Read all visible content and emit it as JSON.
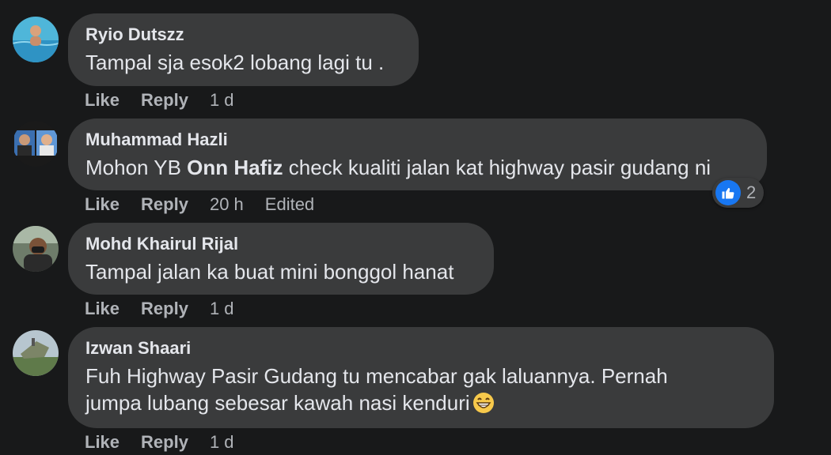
{
  "comments": [
    {
      "author": "Ryio Dutszz",
      "text": "Tampal sja esok2 lobang lagi tu .",
      "like_label": "Like",
      "reply_label": "Reply",
      "time": "1 d"
    },
    {
      "author": "Muhammad Hazli",
      "text_before": "Mohon YB ",
      "mention": "Onn Hafiz",
      "text_after": " check kualiti jalan kat highway pasir gudang ni",
      "like_label": "Like",
      "reply_label": "Reply",
      "time": "20 h",
      "edited_label": "Edited",
      "reaction": {
        "icon": "thumbs-up-icon",
        "count": "2",
        "color": "#1877f2"
      }
    },
    {
      "author": "Mohd Khairul Rijal",
      "text": "Tampal jalan ka buat mini bonggol hanat",
      "like_label": "Like",
      "reply_label": "Reply",
      "time": "1 d"
    },
    {
      "author": "Izwan Shaari",
      "text_line1": "Fuh Highway Pasir Gudang tu mencabar gak laluannya. Pernah",
      "text_line2": "jumpa lubang sebesar kawah nasi kenduri",
      "emoji": "grinning-face-emoji",
      "like_label": "Like",
      "reply_label": "Reply",
      "time": "1 d"
    }
  ],
  "colors": {
    "background": "#18191a",
    "bubble": "#3a3b3c",
    "primary_text": "#e4e6eb",
    "secondary_text": "#b0b3b8"
  }
}
